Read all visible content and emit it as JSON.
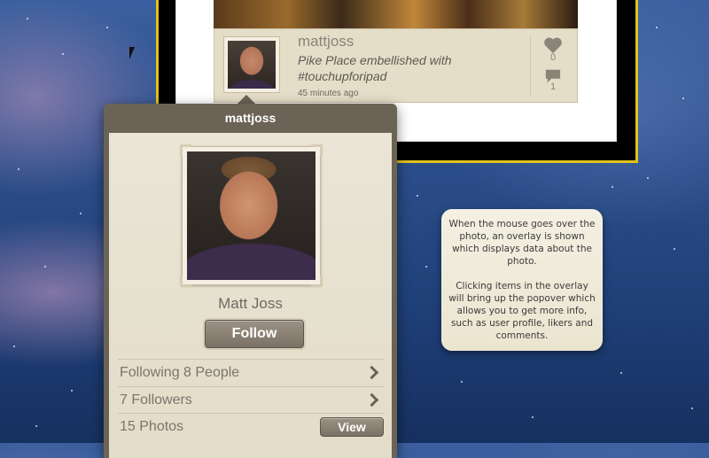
{
  "photo_overlay": {
    "username": "mattjoss",
    "caption": "Pike Place embellished with #touchupforipad",
    "time": "45 minutes ago",
    "likes_count": "0",
    "comments_count": "1",
    "icons": [
      "heart-icon",
      "comment-bubble-icon",
      "thumbnail-avatar"
    ]
  },
  "popover": {
    "title": "mattjoss",
    "full_name": "Matt Joss",
    "follow_label": "Follow",
    "rows": [
      {
        "label": "Following 8 People"
      },
      {
        "label": "7 Followers"
      },
      {
        "label": "15 Photos",
        "action": "View"
      }
    ]
  },
  "note": {
    "paragraph1": "When the mouse goes over the photo, an overlay is shown which displays data about the photo.",
    "paragraph2": "Clicking items in the overlay will bring up the popover which allows you to get more info, such as user profile, likers and comments."
  },
  "colors": {
    "frame_border": "#e2c21a",
    "popover_bg": "#6c6357",
    "paper": "#eae5d6",
    "button": "#8a8174"
  }
}
